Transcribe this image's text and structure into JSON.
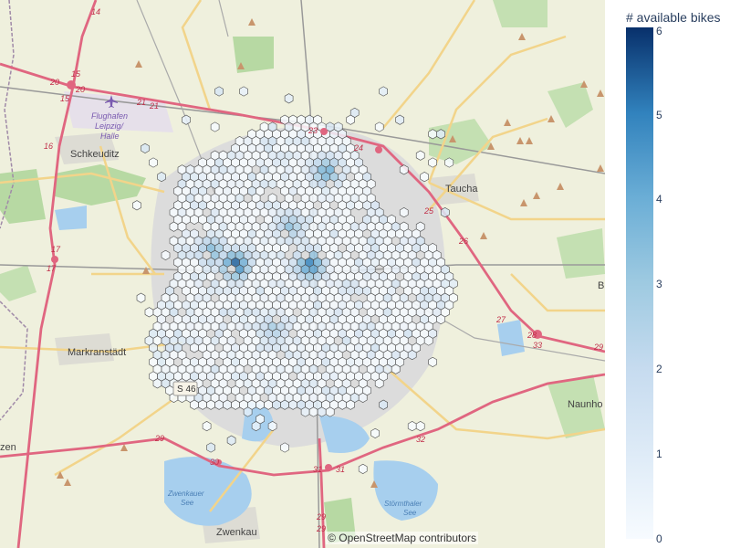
{
  "map": {
    "places": [
      {
        "id": "schkeuditz",
        "label": "Schkeuditz"
      },
      {
        "id": "taucha",
        "label": "Taucha"
      },
      {
        "id": "markranstaedt",
        "label": "Markranstädt"
      },
      {
        "id": "zwenkau",
        "label": "Zwenkau"
      },
      {
        "id": "naunhof",
        "label": "Naunho"
      },
      {
        "id": "zen",
        "label": "zen"
      },
      {
        "id": "b",
        "label": "B"
      }
    ],
    "airport": {
      "line1": "Flughafen",
      "line2": "Leipzig/",
      "line3": "Halle"
    },
    "lakes": {
      "zwenkauer1": "Zwenkauer",
      "zwenkauer2": "See",
      "stoermthaler1": "Störmthaler",
      "stoermthaler2": "See"
    },
    "road_shield": "S 46",
    "road_numbers": [
      "14",
      "15",
      "20",
      "20",
      "15",
      "21",
      "21",
      "16",
      "17",
      "17",
      "23",
      "24",
      "25",
      "26",
      "27",
      "28",
      "33",
      "29",
      "29",
      "30",
      "31",
      "31",
      "32",
      "29",
      "29"
    ],
    "attribution": "© OpenStreetMap contributors"
  },
  "colorbar": {
    "title": "# available bikes",
    "ticks": [
      "0",
      "1",
      "2",
      "3",
      "4",
      "5",
      "6"
    ],
    "colors": [
      "#f7fbff",
      "#deebf7",
      "#c6dbef",
      "#9ecae1",
      "#6baed6",
      "#3182bd",
      "#08306b"
    ]
  },
  "hexbin": {
    "type": "hexbin-mapbox",
    "value_range": [
      0,
      6
    ],
    "highlights": [
      {
        "name": "center-west",
        "value": 6
      },
      {
        "name": "center-east",
        "value": 5.5
      },
      {
        "name": "north-center",
        "value": 4.5
      },
      {
        "name": "west-center",
        "value": 4
      },
      {
        "name": "center",
        "value": 3.5
      },
      {
        "name": "south-center",
        "value": 3
      }
    ]
  }
}
